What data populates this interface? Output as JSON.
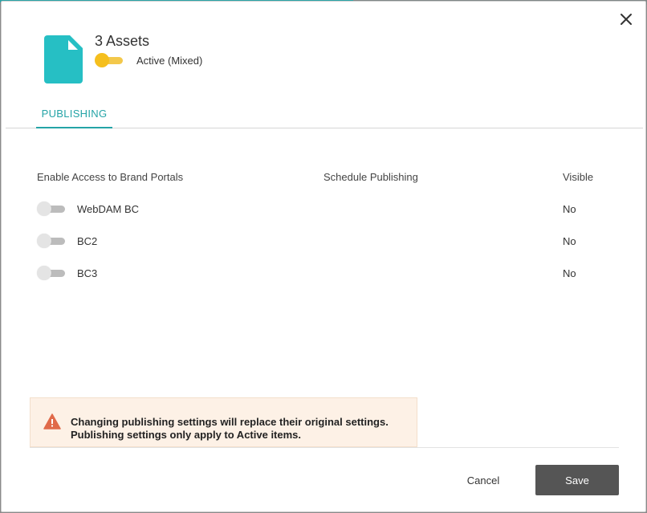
{
  "header": {
    "title": "3 Assets",
    "status_label": "Active (Mixed)",
    "doc_icon": "document-icon",
    "colors": {
      "doc": "#26bfc4",
      "toggle_active": "#f5bf1e"
    }
  },
  "tabs": [
    {
      "label": "PUBLISHING",
      "active": true
    }
  ],
  "columns": {
    "enable": "Enable Access to Brand Portals",
    "schedule": "Schedule Publishing",
    "visible": "Visible"
  },
  "portals": [
    {
      "name": "WebDAM BC",
      "visible": "No",
      "enabled": false
    },
    {
      "name": "BC2",
      "visible": "No",
      "enabled": false
    },
    {
      "name": "BC3",
      "visible": "No",
      "enabled": false
    }
  ],
  "warning": {
    "icon": "warning-triangle-icon",
    "line1": "Changing publishing settings will replace their original settings.",
    "line2": "Publishing settings only apply to Active items.",
    "color": "#e06a4a"
  },
  "footer": {
    "cancel_label": "Cancel",
    "save_label": "Save"
  },
  "close_icon": "close-icon"
}
